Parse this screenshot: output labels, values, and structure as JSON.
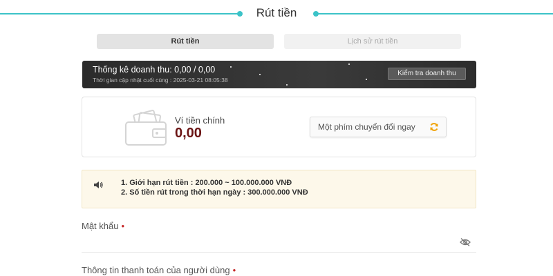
{
  "page": {
    "title": "Rút tiền"
  },
  "tabs": [
    {
      "label": "Rút tiền",
      "active": true
    },
    {
      "label": "Lịch sử rút tiền",
      "active": false
    }
  ],
  "revenue": {
    "title": "Thống kê doanh thu: 0,00 / 0,00",
    "updated": "Thời gian cập nhật cuối cùng : 2025-03-21 08:05:38",
    "button_label": "Kiểm tra doanh thu"
  },
  "wallet": {
    "label": "Ví tiền chính",
    "amount": "0,00",
    "convert_label": "Một phím chuyển đổi ngay",
    "icon": "wallet-icon"
  },
  "notice": {
    "icon": "speaker-icon",
    "items": [
      "1. Giới hạn rút tiền : 200.000 ~ 100.000.000 VNĐ",
      "2. Số tiền rút trong thời hạn ngày : 300.000.000 VNĐ"
    ]
  },
  "form": {
    "password_label": "Mật khẩu",
    "required_mark": "•",
    "payment_label": "Thông tin thanh toán của người dùng"
  },
  "colors": {
    "accent": "#3cc3c8",
    "amount": "#6b1414",
    "refresh": "#f0a30a",
    "required": "#c62828"
  }
}
